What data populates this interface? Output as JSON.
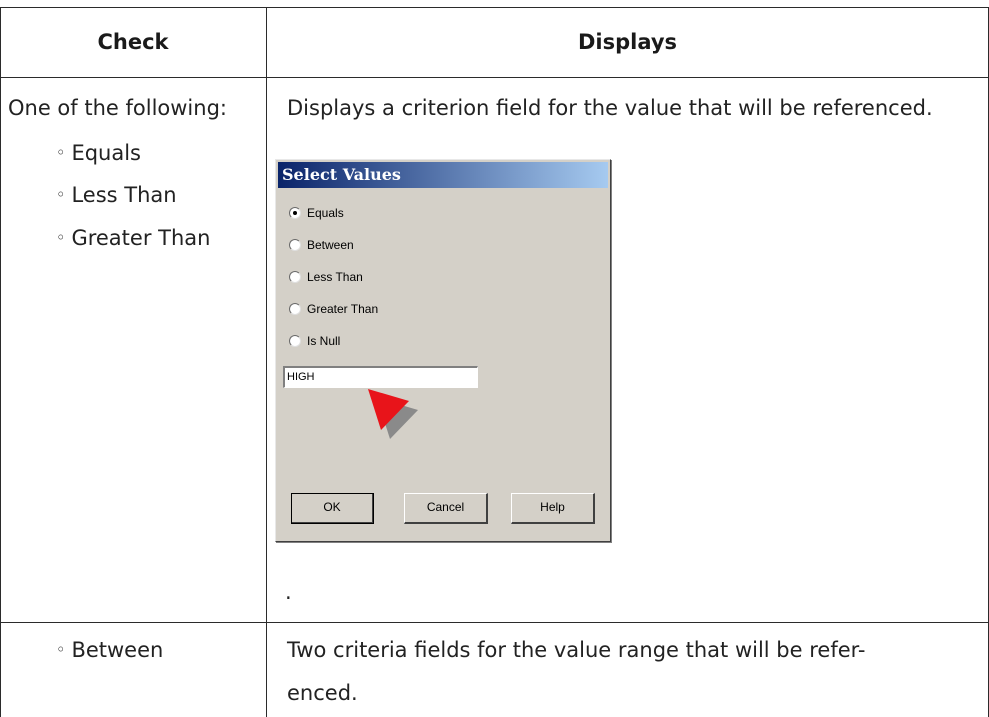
{
  "table": {
    "headers": {
      "check": "Check",
      "displays": "Displays"
    },
    "rows": [
      {
        "check": "One of the following:",
        "check_items": [
          "Equals",
          "Less Than",
          "Greater Than"
        ],
        "displays": "Displays a criterion field for the value that will be referenced.",
        "trailing": "."
      },
      {
        "check_items": [
          "Between"
        ],
        "displays_lines": [
          "Two criteria fields for the value range that will be refer-",
          "enced."
        ]
      }
    ]
  },
  "dialog": {
    "title": "Select Values",
    "options": [
      {
        "label": "Equals",
        "checked": true
      },
      {
        "label": "Between",
        "checked": false
      },
      {
        "label": "Less Than",
        "checked": false
      },
      {
        "label": "Greater Than",
        "checked": false
      },
      {
        "label": "Is Null",
        "checked": false
      }
    ],
    "input_value": "HIGH",
    "buttons": {
      "ok": "OK",
      "cancel": "Cancel",
      "help": "Help"
    },
    "pointer_color": "#e8141a"
  }
}
